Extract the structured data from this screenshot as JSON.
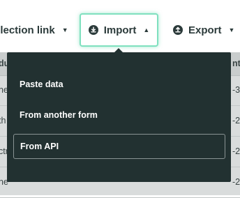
{
  "toolbar": {
    "collection_link": {
      "label": "ollection link",
      "caret": "▼"
    },
    "import": {
      "label": "Import",
      "caret": "▲",
      "icon": "import-icon"
    },
    "export": {
      "label": "Export",
      "caret": "▼",
      "icon": "export-icon"
    }
  },
  "table": {
    "header": {
      "left": "du",
      "right": "nte"
    },
    "rows": [
      {
        "left": "ne",
        "right": "-3"
      },
      {
        "left": "th",
        "right": "-2"
      },
      {
        "left": "ctr",
        "right": "-2"
      },
      {
        "left": "ne",
        "right": "-2"
      }
    ]
  },
  "import_menu": {
    "items": [
      {
        "label": "Paste data"
      },
      {
        "label": "From another form"
      },
      {
        "label": "From API"
      }
    ]
  },
  "colors": {
    "menu_bg": "#223131",
    "accent_focus": "#7fe0bf",
    "text_dark": "#2b3a3a"
  }
}
